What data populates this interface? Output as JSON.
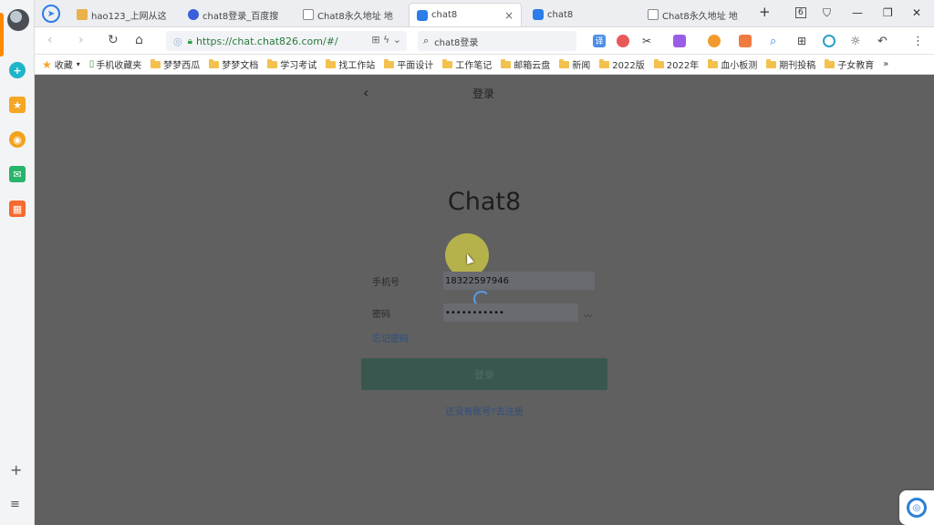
{
  "tabs": [
    {
      "label": "hao123_上网从这",
      "icon": "hao123-icon"
    },
    {
      "label": "chat8登录_百度搜",
      "icon": "baidu-icon"
    },
    {
      "label": "Chat8永久地址 地",
      "icon": "page-icon"
    },
    {
      "label": "chat8",
      "icon": "chat-icon",
      "active": true,
      "close": "×"
    },
    {
      "label": "chat8",
      "icon": "chat-icon"
    },
    {
      "label": "Chat8永久地址 地",
      "icon": "page-icon"
    }
  ],
  "tab_new": "+",
  "window_controls": {
    "tab_count": "6",
    "shirt": "⛉",
    "minimize": "—",
    "restore": "❐",
    "close": "✕"
  },
  "toolbar": {
    "url": "https://chat.chat826.com/#/",
    "search_query": "chat8登录",
    "translate_label": "译"
  },
  "bookmarks": {
    "favorites_label": "收藏",
    "items": [
      "手机收藏夹",
      "梦梦西瓜",
      "梦梦文档",
      "学习考试",
      "找工作站",
      "平面设计",
      "工作笔记",
      "邮箱云盘",
      "新闻",
      "2022版",
      "2022年",
      "血小板测",
      "期刊投稿",
      "子女教育"
    ],
    "more": "»"
  },
  "page": {
    "back_symbol": "‹",
    "heading": "登录",
    "app_title": "Chat8",
    "phone_label": "手机号",
    "phone_value": "18322597946",
    "password_label": "密码",
    "password_value": "•••••••••••",
    "eye_symbol": "〰",
    "forgot_label": "忘记密码",
    "login_button": "登录",
    "register_link": "还没有账号?去注册"
  },
  "colors": {
    "accent": "#2b7de9",
    "overlay": "#606060",
    "login_button": "#3a574f",
    "link": "#2d4f82"
  }
}
